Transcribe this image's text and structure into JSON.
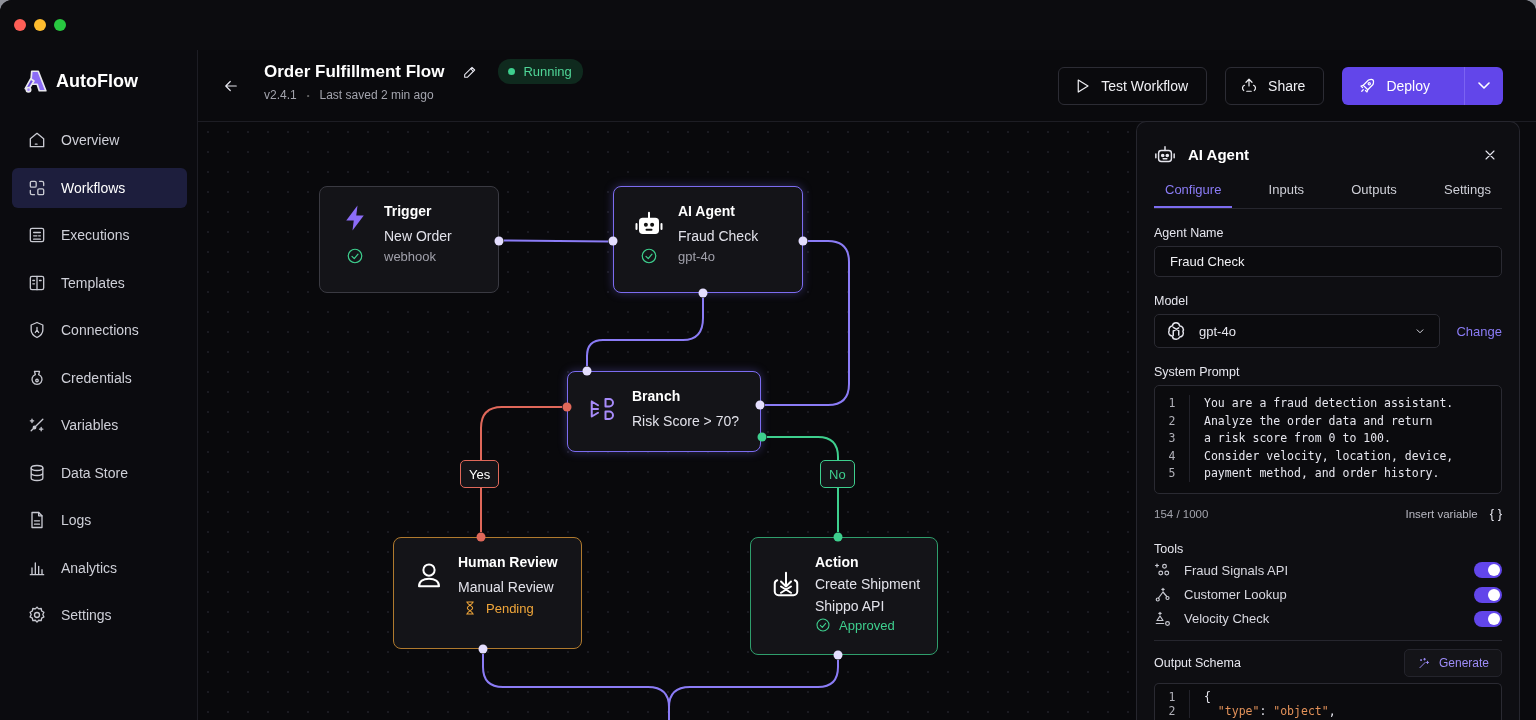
{
  "brand": {
    "name": "AutoFlow"
  },
  "sidebar": {
    "items": [
      {
        "label": "Overview",
        "selected": false
      },
      {
        "label": "Workflows",
        "selected": true
      },
      {
        "label": "Executions",
        "selected": false
      },
      {
        "label": "Templates",
        "selected": false
      },
      {
        "label": "Connections",
        "selected": false
      },
      {
        "label": "Credentials",
        "selected": false
      },
      {
        "label": "Variables",
        "selected": false
      },
      {
        "label": "Data Store",
        "selected": false
      },
      {
        "label": "Logs",
        "selected": false
      },
      {
        "label": "Analytics",
        "selected": false
      },
      {
        "label": "Settings",
        "selected": false
      }
    ]
  },
  "header": {
    "title": "Order Fulfillment Flow",
    "status": "Running",
    "version": "v2.4.1",
    "separator": "•",
    "saved": "Last saved 2 min ago",
    "buttons": [
      {
        "kind": "outline",
        "label": "Test Workflow"
      },
      {
        "kind": "outline",
        "label": "Share"
      },
      {
        "kind": "primary",
        "label": "Deploy"
      }
    ]
  },
  "canvas": {
    "nodes": [
      {
        "kind": "trigger",
        "title": "Trigger",
        "lines": [
          "New Order"
        ],
        "status": {
          "kind": "done",
          "text": "webhook"
        }
      },
      {
        "kind": "agent",
        "title": "AI Agent",
        "lines": [
          "Fraud Check"
        ],
        "status": {
          "kind": "done",
          "text": "gpt-4o"
        }
      },
      {
        "kind": "branch",
        "title": "Branch",
        "lines": [
          "Risk Score > 70?"
        ]
      },
      {
        "kind": "human",
        "title": "Human Review",
        "lines": [
          "Manual Review"
        ],
        "status": {
          "kind": "pending",
          "text": "Pending"
        }
      },
      {
        "kind": "action",
        "title": "Action",
        "lines": [
          "Create Shipment",
          "Shippo API"
        ],
        "status": {
          "kind": "approved",
          "text": "Approved"
        }
      }
    ],
    "edges": [
      {
        "color": "#8b7cf6"
      },
      {
        "color": "#8b7cf6"
      },
      {
        "color": "#8b7cf6"
      },
      {
        "label": "Yes",
        "color": "#e0685a"
      },
      {
        "label": "No",
        "color": "#3ecf8e"
      },
      {
        "color": "#8b7cf6"
      },
      {
        "color": "#8b7cf6"
      }
    ]
  },
  "panel": {
    "title": "AI Agent",
    "tabs": [
      {
        "label": "Configure",
        "selected": true
      },
      {
        "label": "Inputs",
        "selected": false
      },
      {
        "label": "Outputs",
        "selected": false
      },
      {
        "label": "Settings",
        "selected": false
      }
    ],
    "agent_name": {
      "label": "Agent Name",
      "value": "Fraud Check"
    },
    "model": {
      "label": "Model",
      "value": "gpt-4o",
      "action": "Change"
    },
    "prompt": {
      "label": "System Prompt",
      "lines": [
        {
          "number": "1",
          "text": "You are a fraud detection assistant."
        },
        {
          "number": "2",
          "text": "Analyze the order data and return"
        },
        {
          "number": "3",
          "text": "a risk score from 0 to 100."
        },
        {
          "number": "4",
          "text": "Consider velocity, location, device,"
        },
        {
          "number": "5",
          "text": "payment method, and order history."
        }
      ],
      "counter": "154 / 1000",
      "insert_label": "Insert variable",
      "insert_symbol": "{ }"
    },
    "tools": {
      "label": "Tools",
      "items": [
        {
          "label": "Fraud Signals API",
          "on": true
        },
        {
          "label": "Customer Lookup",
          "on": true
        },
        {
          "label": "Velocity Check",
          "on": true
        }
      ]
    },
    "schema": {
      "label": "Output Schema",
      "action": "Generate",
      "lines": [
        {
          "number": "1",
          "text": "{"
        },
        {
          "number": "2",
          "text": "  \"type\": \"object\","
        }
      ]
    }
  }
}
